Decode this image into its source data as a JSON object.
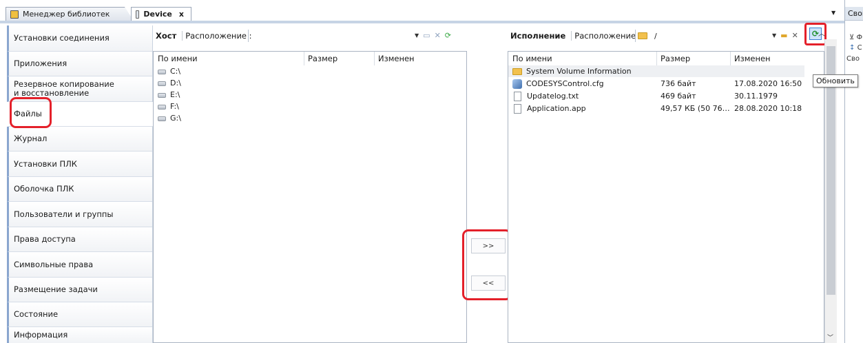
{
  "tabs": {
    "library_manager": "Менеджер библиотек",
    "device": "Device",
    "close_glyph": "x"
  },
  "properties_panel": {
    "header": "Свой",
    "line1": "Ф",
    "line2": "С",
    "line3": "Сво"
  },
  "sidebar": {
    "items": [
      {
        "label": "Установки соединения"
      },
      {
        "label": "Приложения"
      },
      {
        "label": "Резервное копирование и восстановление"
      },
      {
        "label": "Файлы"
      },
      {
        "label": "Журнал"
      },
      {
        "label": "Установки ПЛК"
      },
      {
        "label": "Оболочка ПЛК"
      },
      {
        "label": "Пользователи и группы"
      },
      {
        "label": "Права доступа"
      },
      {
        "label": "Символьные права"
      },
      {
        "label": "Размещение задачи"
      },
      {
        "label": "Состояние"
      },
      {
        "label": "Информация"
      }
    ],
    "active_index": 3
  },
  "host": {
    "title": "Хост",
    "location_label": "Расположение :",
    "location_value": "",
    "columns": [
      "По имени",
      "Размер",
      "Изменен"
    ],
    "rows": [
      {
        "name": "C:\\",
        "size": "",
        "modified": ""
      },
      {
        "name": "D:\\",
        "size": "",
        "modified": ""
      },
      {
        "name": "E:\\",
        "size": "",
        "modified": ""
      },
      {
        "name": "F:\\",
        "size": "",
        "modified": ""
      },
      {
        "name": "G:\\",
        "size": "",
        "modified": ""
      }
    ]
  },
  "transfer": {
    "to_runtime": ">>",
    "to_host": "<<"
  },
  "runtime": {
    "title": "Исполнение",
    "location_label": "Расположение :",
    "location_value": "/",
    "columns": [
      "По имени",
      "Размер",
      "Изменен"
    ],
    "rows": [
      {
        "name": "System Volume Information",
        "size": "",
        "modified": "",
        "icon": "folder-icon"
      },
      {
        "name": "CODESYSControl.cfg",
        "size": "736 байт",
        "modified": "17.08.2020 16:50",
        "icon": "config-file-icon"
      },
      {
        "name": "Updatelog.txt",
        "size": "469 байт",
        "modified": "30.11.1979",
        "icon": "file-icon"
      },
      {
        "name": "Application.app",
        "size": "49,57 КБ (50 76…",
        "modified": "28.08.2020 10:18",
        "icon": "file-icon"
      }
    ],
    "refresh_tooltip": "Обновить"
  },
  "colors": {
    "highlight_ring": "#e4202a",
    "nav_accent": "#8aa6cf",
    "refresh_green": "#1f8f2a"
  }
}
